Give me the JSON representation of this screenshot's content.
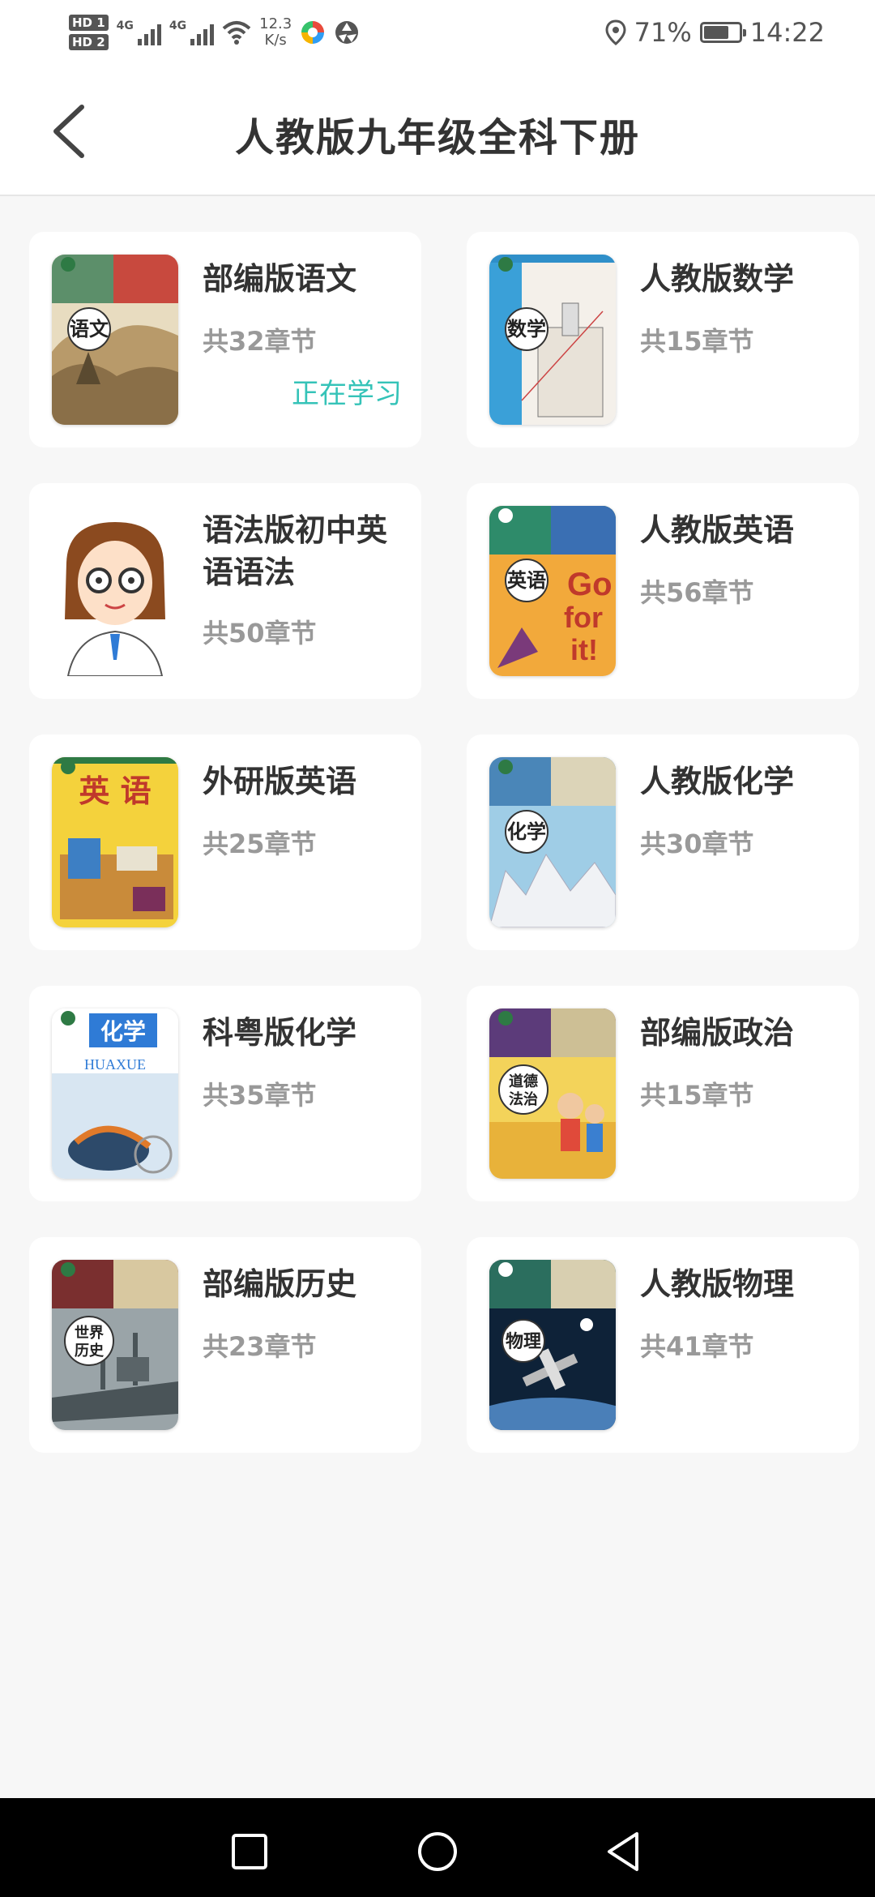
{
  "status_bar": {
    "hd1": "HD 1",
    "hd2": "HD 2",
    "net1": "4G",
    "net2": "4G",
    "speed_value": "12.3",
    "speed_unit": "K/s",
    "battery_text": "71%",
    "battery_level": 0.71,
    "time": "14:22"
  },
  "header": {
    "title": "人教版九年级全科下册",
    "back_icon": "chevron-left-icon"
  },
  "books": [
    {
      "title": "部编版语文",
      "chapters": "共32章节",
      "status": "正在学习",
      "cover_label": "语文"
    },
    {
      "title": "人教版数学",
      "chapters": "共15章节",
      "cover_label": "数学"
    },
    {
      "title": "语法版初中英语语法",
      "chapters": "共50章节",
      "cover_label": ""
    },
    {
      "title": "人教版英语",
      "chapters": "共56章节",
      "cover_label": "英语"
    },
    {
      "title": "外研版英语",
      "chapters": "共25章节",
      "cover_label": "英 语"
    },
    {
      "title": "人教版化学",
      "chapters": "共30章节",
      "cover_label": "化学"
    },
    {
      "title": "科粤版化学",
      "chapters": "共35章节",
      "cover_label": "化学"
    },
    {
      "title": "部编版政治",
      "chapters": "共15章节",
      "cover_label": "道德与法治"
    },
    {
      "title": "部编版历史",
      "chapters": "共23章节",
      "cover_label": "世界历史"
    },
    {
      "title": "人教版物理",
      "chapters": "共41章节",
      "cover_label": "物理"
    }
  ],
  "colors": {
    "accent": "#35c3b8",
    "card_bg": "#ffffff",
    "page_bg": "#f7f7f7"
  },
  "nav_bar": {
    "recent_icon": "square-icon",
    "home_icon": "circle-icon",
    "back_icon": "triangle-back-icon"
  }
}
